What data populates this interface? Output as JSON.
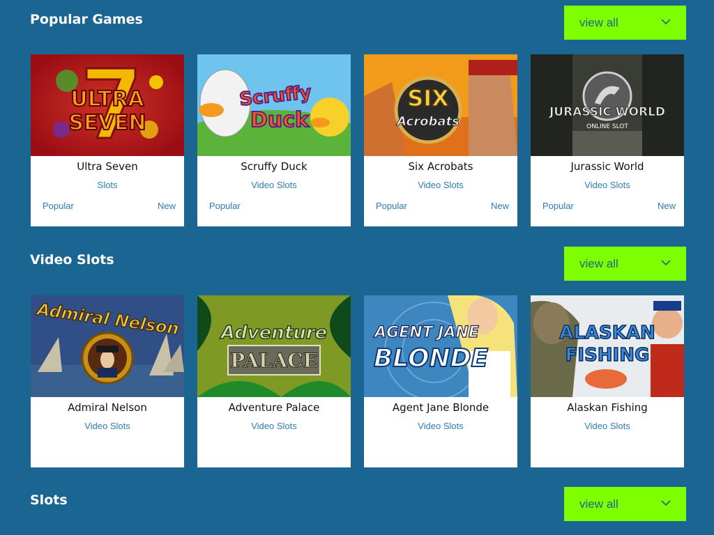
{
  "sections": [
    {
      "title": "Popular Games",
      "view_all": "view all",
      "games": [
        {
          "name": "Ultra Seven",
          "category": "Slots",
          "tag_left": "Popular",
          "tag_right": "New",
          "logo_lines": [
            "ULTRA",
            "SEVEN"
          ]
        },
        {
          "name": "Scruffy Duck",
          "category": "Video Slots",
          "tag_left": "Popular",
          "tag_right": "",
          "logo_lines": [
            "Scruffy",
            "Duck"
          ]
        },
        {
          "name": "Six Acrobats",
          "category": "Video Slots",
          "tag_left": "Popular",
          "tag_right": "New",
          "logo_lines": [
            "SIX",
            "Acrobats"
          ]
        },
        {
          "name": "Jurassic World",
          "category": "Video Slots",
          "tag_left": "Popular",
          "tag_right": "New",
          "logo_lines": [
            "JURASSIC WORLD",
            "ONLINE SLOT"
          ]
        }
      ]
    },
    {
      "title": "Video Slots",
      "view_all": "view all",
      "games": [
        {
          "name": "Admiral Nelson",
          "category": "Video Slots",
          "tag_left": "",
          "tag_right": "",
          "logo_lines": [
            "Admiral Nelson"
          ]
        },
        {
          "name": "Adventure Palace",
          "category": "Video Slots",
          "tag_left": "",
          "tag_right": "",
          "logo_lines": [
            "Adventure",
            "PALACE"
          ]
        },
        {
          "name": "Agent Jane Blonde",
          "category": "Video Slots",
          "tag_left": "",
          "tag_right": "",
          "logo_lines": [
            "AGENT JANE",
            "BLONDE"
          ]
        },
        {
          "name": "Alaskan Fishing",
          "category": "Video Slots",
          "tag_left": "",
          "tag_right": "",
          "logo_lines": [
            "ALASKAN",
            "FISHING"
          ]
        }
      ]
    },
    {
      "title": "Slots",
      "view_all": "view all",
      "games": []
    }
  ],
  "colors": {
    "background": "#1a6591",
    "view_all_button": "#7dff00",
    "link_text": "#2c7cb6",
    "card_background": "#ffffff"
  },
  "icons": {
    "view_all_dropdown": "chevron-down-icon"
  }
}
